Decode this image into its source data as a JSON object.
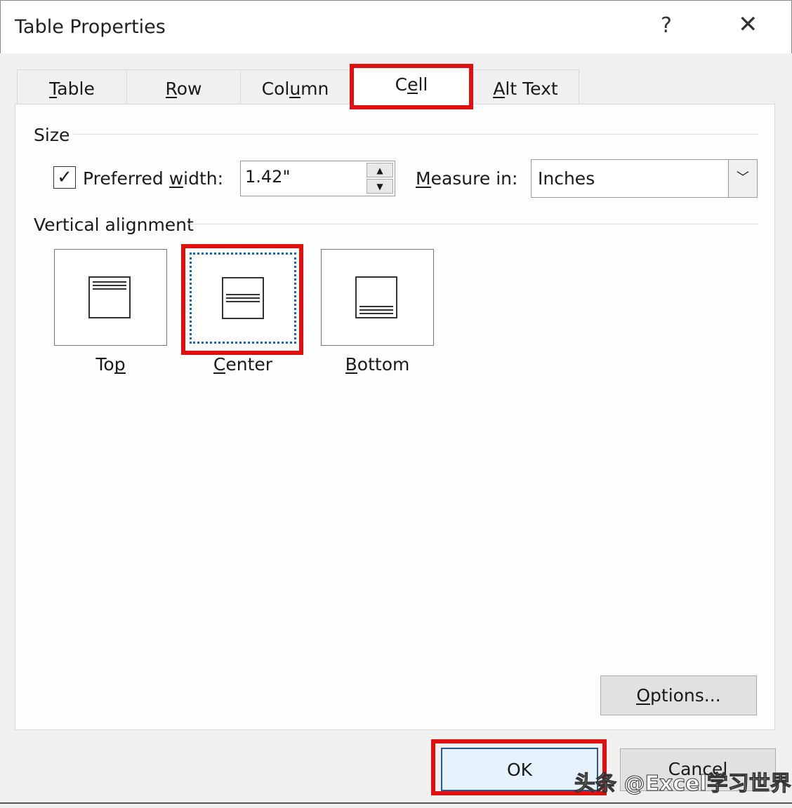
{
  "window": {
    "title": "Table Properties",
    "help_icon": "question-mark",
    "close_icon": "x"
  },
  "tabs": [
    {
      "label": "Table",
      "access_key_index": 0
    },
    {
      "label": "Row",
      "access_key_index": 0
    },
    {
      "label": "Column",
      "access_key_index": 3
    },
    {
      "label": "Cell",
      "access_key_index": 1,
      "selected": true
    },
    {
      "label": "Alt Text",
      "access_key_index": 0
    }
  ],
  "size": {
    "section_label": "Size",
    "preferred_width_label": "Preferred width:",
    "preferred_width_checked": true,
    "preferred_width_value": "1.42\"",
    "measure_in_label": "Measure in:",
    "measure_in_value": "Inches"
  },
  "vertical_alignment": {
    "section_label": "Vertical alignment",
    "options": [
      {
        "label": "Top",
        "access_key_index": 2
      },
      {
        "label": "Center",
        "access_key_index": 0,
        "selected": true
      },
      {
        "label": "Bottom",
        "access_key_index": 0
      }
    ]
  },
  "buttons": {
    "options": "Options...",
    "ok": "OK",
    "cancel": "Cancel"
  },
  "highlight_color": "#e01010",
  "watermark": "头条 @Excel学习世界"
}
